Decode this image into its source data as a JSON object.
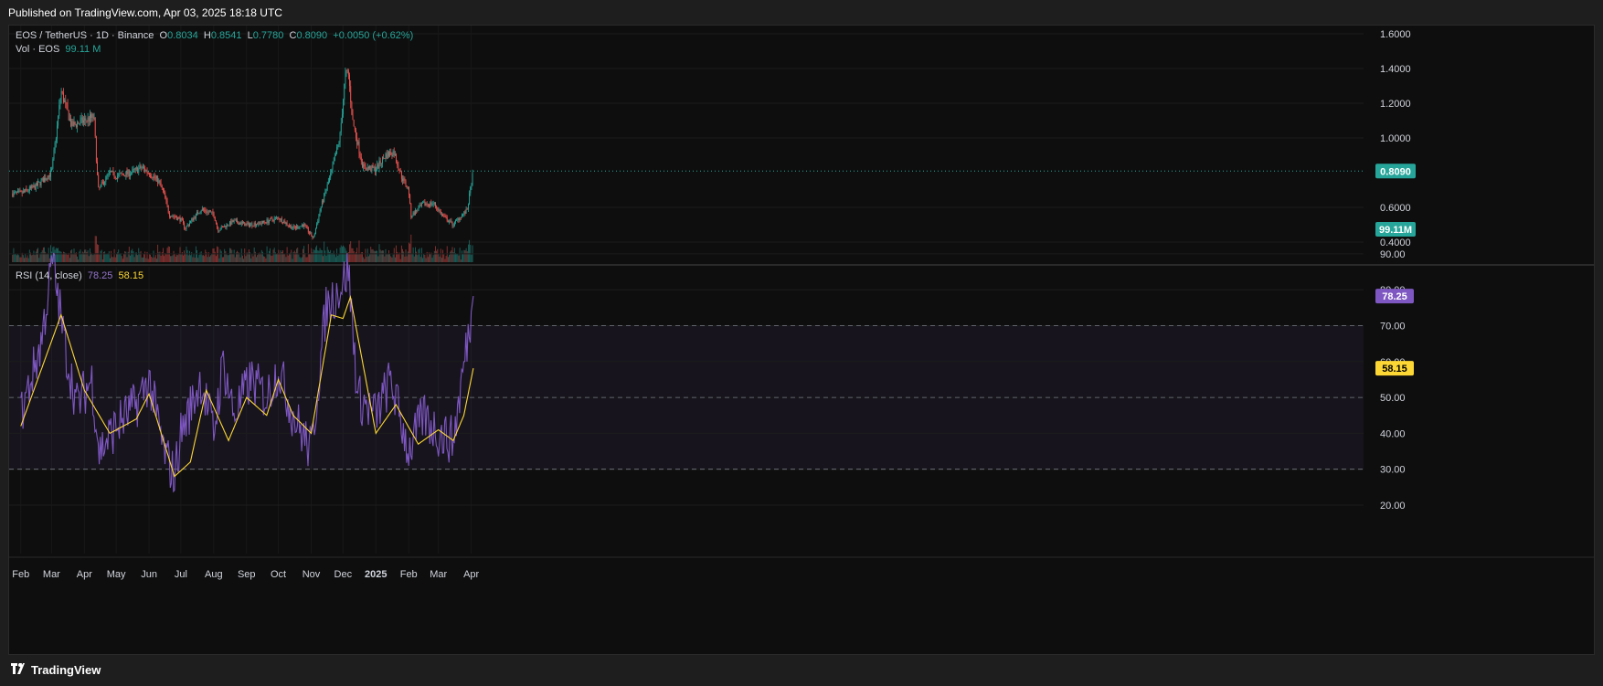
{
  "header": {
    "published": "Published on TradingView.com, Apr 03, 2025 18:18 UTC"
  },
  "footer": {
    "brand": "TradingView"
  },
  "legend": {
    "symbol": "EOS / TetherUS · 1D · Binance",
    "o_label": "O",
    "o": "0.8034",
    "h_label": "H",
    "h": "0.8541",
    "l_label": "L",
    "l": "0.7780",
    "c_label": "C",
    "c": "0.8090",
    "change": "+0.0050 (+0.62%)",
    "vol_label": "Vol · EOS",
    "vol": "99.11 M",
    "rsi_label": "RSI (14, close)",
    "rsi": "78.25",
    "rsi_ma": "58.15"
  },
  "colors": {
    "up": "#26a69a",
    "down": "#ef5350",
    "rsi": "#7e57c2",
    "rsi_ma": "#fdd835",
    "background": "#0e0e0e"
  },
  "chart_data": [
    {
      "type": "candlestick",
      "title": "EOS / TetherUS · 1D · Binance",
      "y_ticks": [
        "1.6000",
        "1.4000",
        "1.2000",
        "1.0000",
        "0.6000",
        "0.4000"
      ],
      "ylim": [
        0.36,
        1.66
      ],
      "x_ticks": [
        "Feb",
        "Mar",
        "Apr",
        "May",
        "Jun",
        "Jul",
        "Aug",
        "Sep",
        "Oct",
        "Nov",
        "Dec",
        "2025",
        "Feb",
        "Mar",
        "Apr"
      ],
      "last_price": 0.809,
      "last_price_label": "0.8090",
      "approx_close_series": {
        "dates": [
          "2024-02-01",
          "2024-02-15",
          "2024-03-01",
          "2024-03-06",
          "2024-03-10",
          "2024-03-20",
          "2024-04-01",
          "2024-04-10",
          "2024-04-14",
          "2024-04-25",
          "2024-05-01",
          "2024-05-15",
          "2024-05-25",
          "2024-06-01",
          "2024-06-10",
          "2024-06-15",
          "2024-06-20",
          "2024-07-01",
          "2024-07-05",
          "2024-07-20",
          "2024-08-01",
          "2024-08-05",
          "2024-08-20",
          "2024-09-01",
          "2024-09-15",
          "2024-10-01",
          "2024-10-15",
          "2024-10-25",
          "2024-11-03",
          "2024-11-10",
          "2024-11-20",
          "2024-11-28",
          "2024-12-03",
          "2024-12-06",
          "2024-12-10",
          "2024-12-20",
          "2025-01-01",
          "2025-01-10",
          "2025-01-18",
          "2025-01-25",
          "2025-02-01",
          "2025-02-03",
          "2025-02-15",
          "2025-02-25",
          "2025-03-05",
          "2025-03-15",
          "2025-03-22",
          "2025-03-28",
          "2025-04-03"
        ],
        "close": [
          0.68,
          0.72,
          0.8,
          1.05,
          1.27,
          1.07,
          1.1,
          1.12,
          0.7,
          0.8,
          0.78,
          0.8,
          0.83,
          0.8,
          0.75,
          0.68,
          0.56,
          0.53,
          0.48,
          0.59,
          0.56,
          0.47,
          0.52,
          0.5,
          0.51,
          0.54,
          0.48,
          0.5,
          0.42,
          0.6,
          0.8,
          1.0,
          1.35,
          1.38,
          1.1,
          0.83,
          0.82,
          0.9,
          0.92,
          0.78,
          0.7,
          0.55,
          0.62,
          0.62,
          0.55,
          0.5,
          0.55,
          0.58,
          0.809
        ]
      }
    },
    {
      "type": "bar",
      "title": "Vol · EOS",
      "last_value_label": "99.11M"
    },
    {
      "type": "line",
      "title": "RSI (14, close)",
      "y_ticks": [
        "90.00",
        "80.00",
        "70.00",
        "60.00",
        "50.00",
        "40.00",
        "30.00",
        "20.00"
      ],
      "ylim": [
        15,
        95
      ],
      "levels": [
        70,
        50,
        30
      ],
      "series": [
        {
          "name": "RSI",
          "last": 78.25,
          "label": "78.25",
          "approx": {
            "dates": [
              "2024-02-01",
              "2024-02-20",
              "2024-03-02",
              "2024-03-15",
              "2024-03-25",
              "2024-04-08",
              "2024-04-15",
              "2024-05-01",
              "2024-05-20",
              "2024-06-01",
              "2024-06-15",
              "2024-06-25",
              "2024-07-01",
              "2024-07-20",
              "2024-08-01",
              "2024-08-10",
              "2024-08-20",
              "2024-09-05",
              "2024-09-20",
              "2024-10-01",
              "2024-10-15",
              "2024-11-01",
              "2024-11-15",
              "2024-12-01",
              "2024-12-06",
              "2024-12-15",
              "2025-01-01",
              "2025-01-15",
              "2025-02-01",
              "2025-02-15",
              "2025-03-01",
              "2025-03-15",
              "2025-03-28",
              "2025-04-03"
            ],
            "values": [
              45,
              65,
              88,
              62,
              48,
              55,
              35,
              42,
              48,
              55,
              35,
              28,
              40,
              55,
              40,
              60,
              45,
              55,
              50,
              58,
              45,
              35,
              75,
              82,
              86,
              50,
              45,
              55,
              35,
              45,
              40,
              38,
              65,
              78.25
            ]
          }
        },
        {
          "name": "RSI-based MA",
          "last": 58.15,
          "label": "58.15",
          "approx": {
            "dates": [
              "2024-02-01",
              "2024-03-10",
              "2024-04-01",
              "2024-04-25",
              "2024-05-20",
              "2024-06-01",
              "2024-06-25",
              "2024-07-10",
              "2024-07-25",
              "2024-08-15",
              "2024-09-01",
              "2024-09-20",
              "2024-10-01",
              "2024-10-15",
              "2024-11-01",
              "2024-11-20",
              "2024-12-01",
              "2024-12-08",
              "2025-01-01",
              "2025-01-20",
              "2025-02-10",
              "2025-03-01",
              "2025-03-15",
              "2025-03-25",
              "2025-04-03"
            ],
            "values": [
              42,
              73,
              52,
              40,
              44,
              51,
              28,
              32,
              52,
              38,
              50,
              45,
              55,
              45,
              40,
              73,
              72,
              78,
              40,
              48,
              37,
              41,
              38,
              45,
              58.15
            ]
          }
        }
      ]
    }
  ]
}
